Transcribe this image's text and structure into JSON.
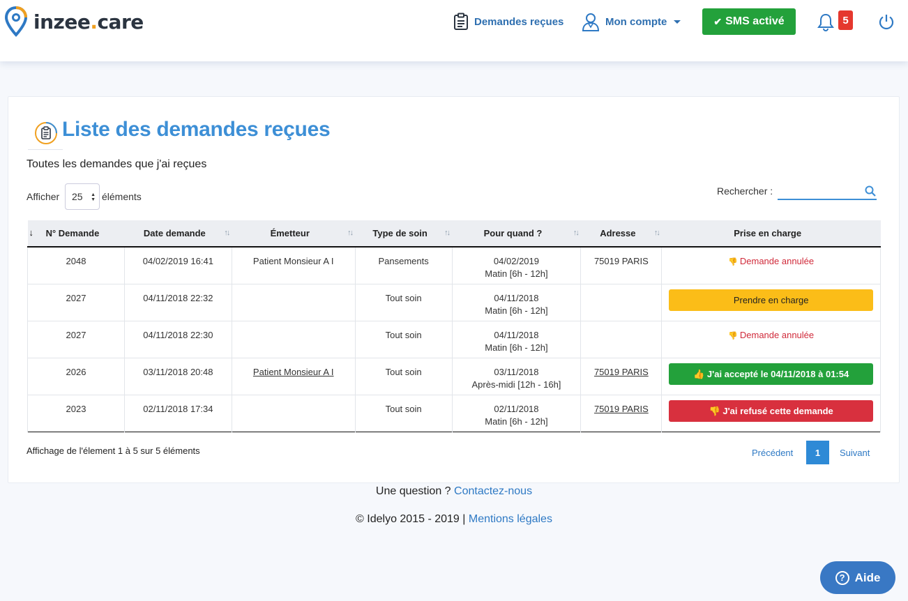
{
  "header": {
    "logo_text_a": "inzee",
    "logo_text_dot": ".",
    "logo_text_b": "care",
    "nav_demandes": "Demandes reçues",
    "nav_compte": "Mon compte",
    "sms_button": "SMS activé",
    "notification_count": "5"
  },
  "page": {
    "title": "Liste des demandes reçues",
    "subtitle": "Toutes les demandes que j'ai reçues",
    "show_label": "Afficher",
    "show_value": "25",
    "show_after": "éléments",
    "search_label": "Rechercher :",
    "search_value": ""
  },
  "table": {
    "columns": [
      "N° Demande",
      "Date demande",
      "Émetteur",
      "Type de soin",
      "Pour quand ?",
      "Adresse",
      "Prise en charge"
    ],
    "rows": [
      {
        "num": "2048",
        "date": "04/02/2019 16:41",
        "emetteur": "Patient Monsieur A I",
        "emetteur_link": false,
        "type": "Pansements",
        "quand1": "04/02/2019",
        "quand2": "Matin [6h - 12h]",
        "adresse": "75019 PARIS",
        "adresse_link": false,
        "status": "Demande annulée",
        "status_kind": "cancel"
      },
      {
        "num": "2027",
        "date": "04/11/2018 22:32",
        "emetteur": "",
        "emetteur_link": false,
        "type": "Tout soin",
        "quand1": "04/11/2018",
        "quand2": "Matin [6h - 12h]",
        "adresse": "",
        "adresse_link": false,
        "status": "Prendre en charge",
        "status_kind": "take"
      },
      {
        "num": "2027",
        "date": "04/11/2018 22:30",
        "emetteur": "",
        "emetteur_link": false,
        "type": "Tout soin",
        "quand1": "04/11/2018",
        "quand2": "Matin [6h - 12h]",
        "adresse": "",
        "adresse_link": false,
        "status": "Demande annulée",
        "status_kind": "cancel"
      },
      {
        "num": "2026",
        "date": "03/11/2018 20:48",
        "emetteur": "Patient Monsieur A I",
        "emetteur_link": true,
        "type": "Tout soin",
        "quand1": "03/11/2018",
        "quand2": "Après-midi [12h - 16h]",
        "adresse": "75019 PARIS",
        "adresse_link": true,
        "status": "J'ai accepté le 04/11/2018 à 01:54",
        "status_kind": "accepted"
      },
      {
        "num": "2023",
        "date": "02/11/2018 17:34",
        "emetteur": "",
        "emetteur_link": false,
        "type": "Tout soin",
        "quand1": "02/11/2018",
        "quand2": "Matin [6h - 12h]",
        "adresse": "75019 PARIS",
        "adresse_link": true,
        "status": "J'ai refusé cette demande",
        "status_kind": "refused"
      }
    ]
  },
  "pagination": {
    "info": "Affichage de l'élement 1 à 5 sur 5 éléments",
    "prev": "Précédent",
    "current": "1",
    "next": "Suivant"
  },
  "footer": {
    "question": "Une question ?",
    "contact": "Contactez-nous",
    "copyright": "© Idelyo 2015 - 2019 |",
    "legal": "Mentions légales"
  },
  "help": {
    "label": "Aide"
  },
  "colors": {
    "brand_blue": "#3d8fd6",
    "success": "#23a13b",
    "warning": "#fbbd18",
    "danger": "#d8303e",
    "badge": "#e5382e"
  }
}
